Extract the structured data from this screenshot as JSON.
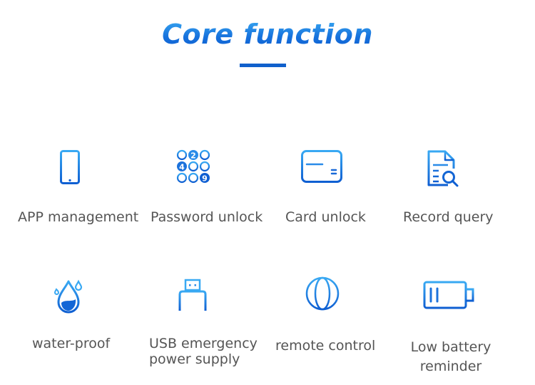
{
  "title": "Core function",
  "colors": {
    "accent": "#1670dc",
    "accent_light": "#3aaaf2",
    "label": "#555555"
  },
  "features": [
    {
      "id": "app",
      "icon": "smartphone-icon",
      "label": "APP management"
    },
    {
      "id": "password",
      "icon": "keypad-icon",
      "label": "Password unlock",
      "keys": [
        "2",
        "4",
        "9"
      ]
    },
    {
      "id": "card",
      "icon": "card-icon",
      "label": "Card unlock"
    },
    {
      "id": "record",
      "icon": "document-search-icon",
      "label": "Record query"
    },
    {
      "id": "water",
      "icon": "water-drop-icon",
      "label": "water-proof"
    },
    {
      "id": "usb",
      "icon": "usb-icon",
      "label_line1": "USB emergency",
      "label_line2": "power supply"
    },
    {
      "id": "remote",
      "icon": "globe-icon",
      "label": "remote control"
    },
    {
      "id": "battery",
      "icon": "low-battery-icon",
      "label_line1": "Low battery",
      "label_line2": "reminder"
    }
  ]
}
